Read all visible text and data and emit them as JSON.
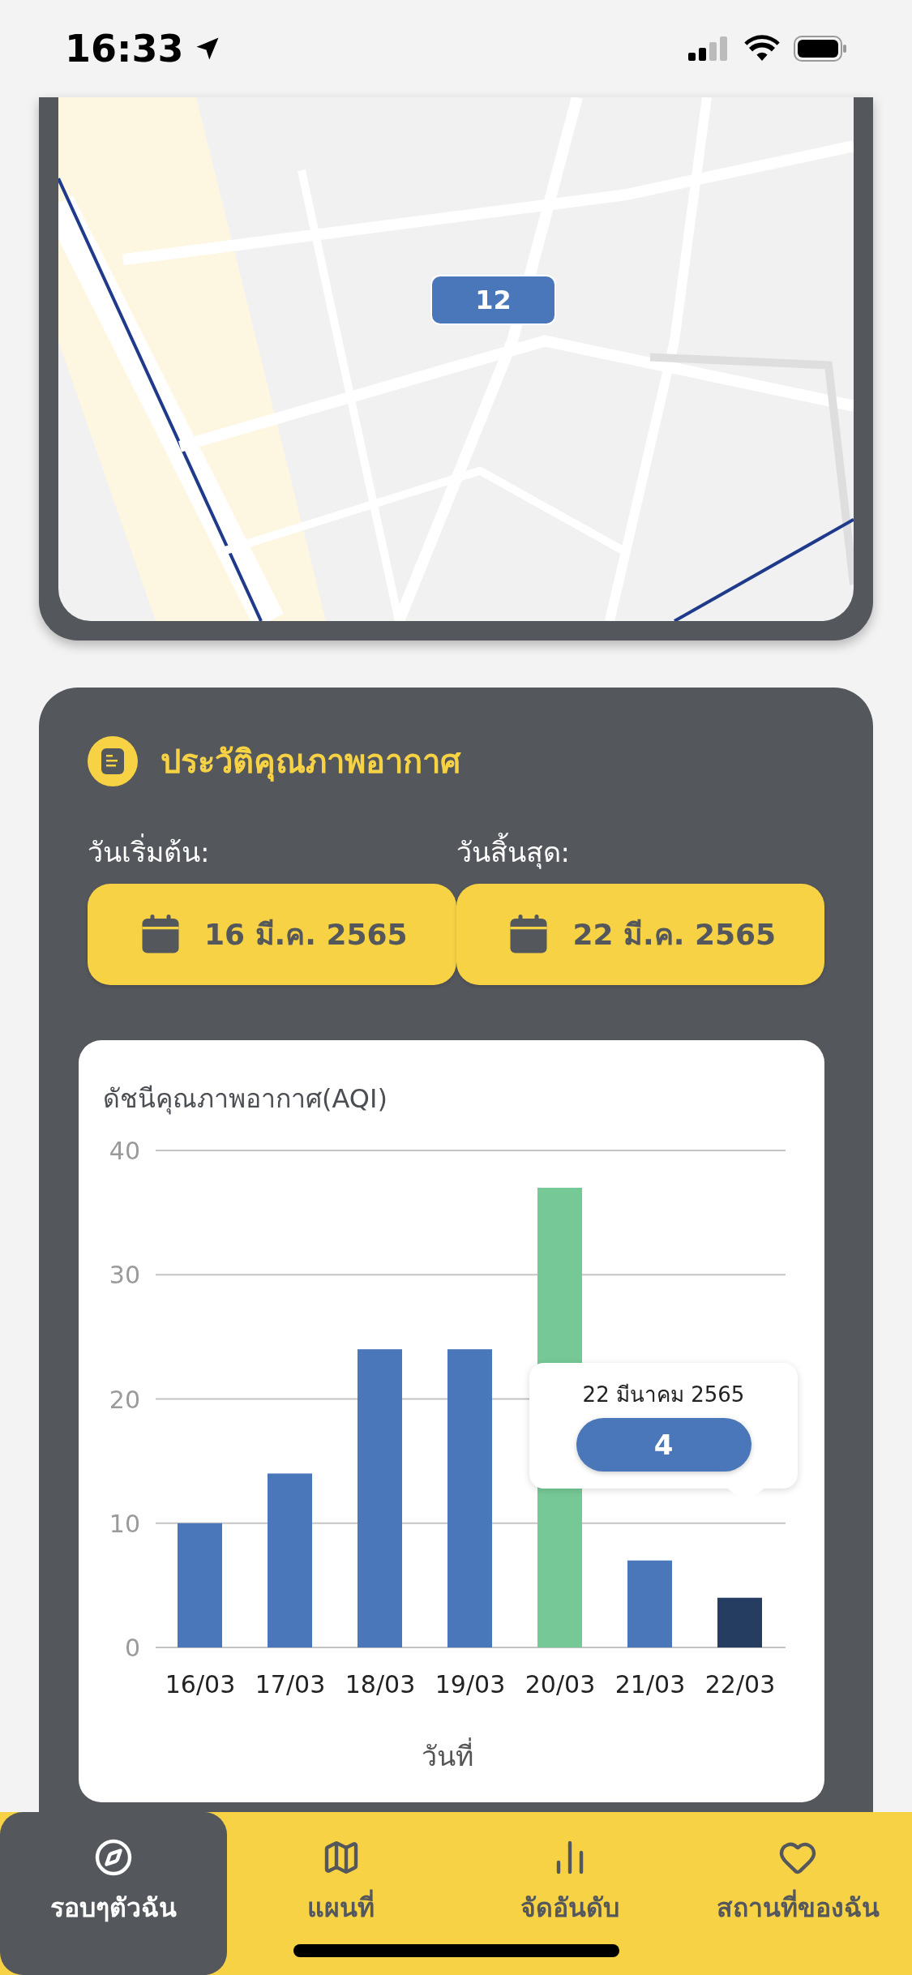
{
  "status_bar": {
    "time": "16:33"
  },
  "map": {
    "kind": "picture",
    "marker": "12"
  },
  "history": {
    "title": "ประวัติคุณภาพอากาศ",
    "start": {
      "label": "วันเริ่มต้น:",
      "value": "16 มี.ค. 2565"
    },
    "end": {
      "label": "วันสิ้นสุด:",
      "value": "22 มี.ค. 2565"
    },
    "chart": {
      "bars": [
        {
          "color": "#4a77b9"
        },
        {
          "color": "#4a77b9"
        },
        {
          "color": "#4a77b9"
        },
        {
          "color": "#4a77b9"
        },
        {
          "color": "#76c996"
        },
        {
          "color": "#4a77b9"
        },
        {
          "color": "#253d60"
        }
      ],
      "tooltip": {
        "date": "22 มีนาคม 2565",
        "value": "4"
      },
      "chart_data": {
        "type": "bar",
        "title": "ดัชนีคุณภาพอากาศ(AQI)",
        "xlabel": "วันที่",
        "categories": [
          "16/03",
          "17/03",
          "18/03",
          "19/03",
          "20/03",
          "21/03",
          "22/03"
        ],
        "values": [
          10,
          14,
          24,
          24,
          37,
          7,
          4
        ],
        "ylim": [
          0,
          40
        ],
        "yticks": [
          0,
          10,
          20,
          30,
          40
        ],
        "grid": true
      }
    }
  },
  "tabs": [
    {
      "label": "รอบๆตัวฉัน",
      "selected": true
    },
    {
      "label": "แผนที่",
      "selected": false
    },
    {
      "label": "จัดอันดับ",
      "selected": false
    },
    {
      "label": "สถานที่ของฉัน",
      "selected": false
    }
  ]
}
